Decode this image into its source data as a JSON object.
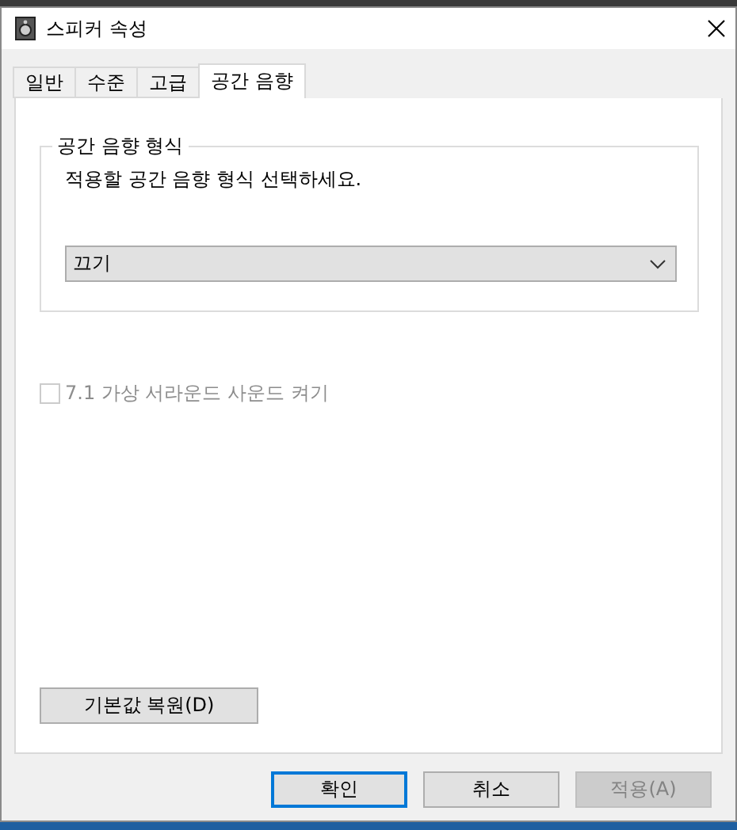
{
  "window": {
    "title": "스피커 속성"
  },
  "tabs": [
    {
      "label": "일반",
      "selected": false
    },
    {
      "label": "수준",
      "selected": false
    },
    {
      "label": "고급",
      "selected": false
    },
    {
      "label": "공간 음향",
      "selected": true
    }
  ],
  "group": {
    "title": "공간 음향 형식",
    "prompt": "적용할 공간 음향 형식 선택하세요.",
    "dropdown": {
      "value": "끄기"
    }
  },
  "checkbox": {
    "label": "7.1 가상 서라운드 사운드 켜기",
    "checked": false,
    "disabled": true
  },
  "restore_button": {
    "label": "기본값 복원(D)"
  },
  "buttons": [
    {
      "label": "확인",
      "focused": true,
      "disabled": false
    },
    {
      "label": "취소",
      "focused": false,
      "disabled": false
    },
    {
      "label": "적용(A)",
      "focused": false,
      "disabled": true
    }
  ]
}
